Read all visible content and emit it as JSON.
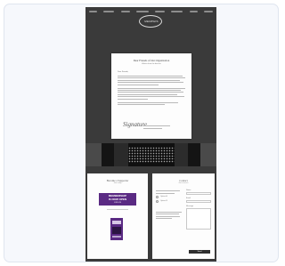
{
  "site": {
    "nav_items": [
      "Home",
      "About",
      "Work",
      "Gallery",
      "Events",
      "Contact",
      "Shop",
      "Donate"
    ],
    "logo_text": "MEMPHIS",
    "letter": {
      "title": "Dear Friends of Our Organization",
      "subtitle": "A letter from the director",
      "greeting": "Dear Friends,",
      "signature": "Signature",
      "sign_note": "Director"
    },
    "promo": {
      "title": "Become a Supporter",
      "subtitle": "Join today",
      "banner_line1": "MEMBERSHIP",
      "banner_line2": "IS NOW OPEN",
      "banner_small": "JOIN US"
    },
    "form": {
      "title": "Contact",
      "subtitle": "Get in touch",
      "labels": [
        "Name",
        "Email",
        "Message"
      ],
      "radio_labels": [
        "Option A",
        "Option B"
      ],
      "submit_label": "Send"
    }
  }
}
